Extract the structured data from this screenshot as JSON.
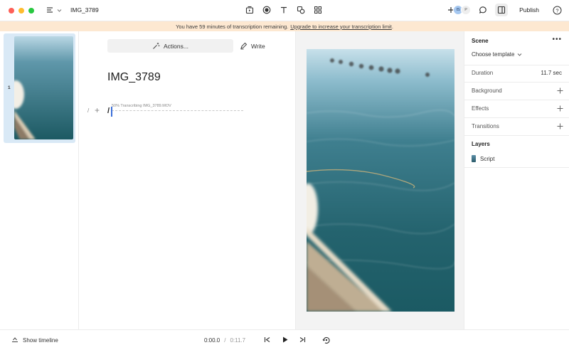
{
  "window": {
    "document_title": "IMG_3789"
  },
  "header": {
    "avatars": [
      "IS",
      "P"
    ],
    "publish_label": "Publish",
    "help_label": "?"
  },
  "banner": {
    "message": "You have 59 minutes of transcription remaining.",
    "link_text": "Upgrade to increase your transcription limit",
    "link_suffix": "."
  },
  "scenes": {
    "items": [
      {
        "number": "1"
      }
    ]
  },
  "editor": {
    "actions_label": "Actions...",
    "write_label": "Write",
    "title": "IMG_3789",
    "transcribing_status": "50% Transcribing IMG_3789.MOV",
    "slash_hint": "/",
    "plus_hint": "+",
    "cursor_text": "/"
  },
  "properties": {
    "scene_heading": "Scene",
    "more_label": "•••",
    "choose_template": "Choose template",
    "duration_label": "Duration",
    "duration_value": "11.7 sec",
    "background_label": "Background",
    "effects_label": "Effects",
    "transitions_label": "Transitions",
    "layers_heading": "Layers",
    "layers": [
      {
        "name": "Script"
      }
    ]
  },
  "timeline": {
    "show_timeline_label": "Show timeline",
    "current_time": "0:00.0",
    "separator": "/",
    "total_time": "0:11.7"
  },
  "colors": {
    "banner_bg": "#fde8d1",
    "selected_scene_bg": "#d9e9f6",
    "caret": "#3b6fd9",
    "water_dark": "#1f5f6e",
    "water_light": "#7fb3c4"
  }
}
